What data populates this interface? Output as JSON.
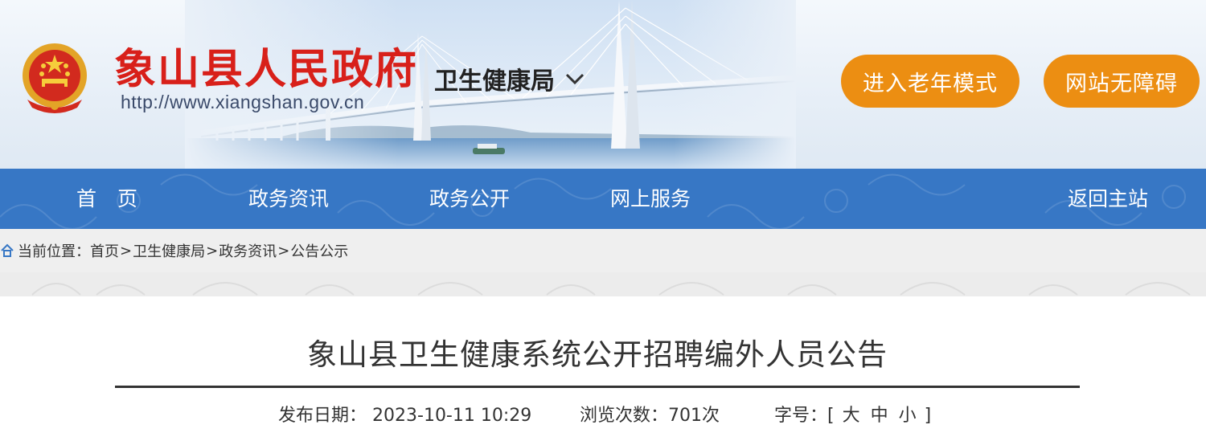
{
  "header": {
    "site_name": "象山县人民政府",
    "site_url": "http://www.xiangshan.gov.cn",
    "department": "卫生健康局",
    "elder_mode_label": "进入老年模式",
    "accessibility_label": "网站无障碍",
    "accent_color": "#ec8e12",
    "brand_color": "#d8201a"
  },
  "nav": {
    "items": [
      {
        "label": "首页"
      },
      {
        "label": "政务资讯"
      },
      {
        "label": "政务公开"
      },
      {
        "label": "网上服务"
      },
      {
        "label": "返回主站"
      }
    ],
    "color": "#3777c5"
  },
  "breadcrumb": {
    "prefix": "当前位置：",
    "items": [
      "首页",
      "卫生健康局",
      "政务资讯",
      "公告公示"
    ],
    "separator": ">"
  },
  "article": {
    "title": "象山县卫生健康系统公开招聘编外人员公告",
    "date_label": "发布日期：",
    "date_value": "2023-10-11 10:29",
    "views_label": "浏览次数：",
    "views_value": "701次",
    "fontsize_label": "字号：",
    "fontsize_open": "[",
    "fontsize_large": "大",
    "fontsize_medium": "中",
    "fontsize_small": "小",
    "fontsize_close": "]"
  }
}
